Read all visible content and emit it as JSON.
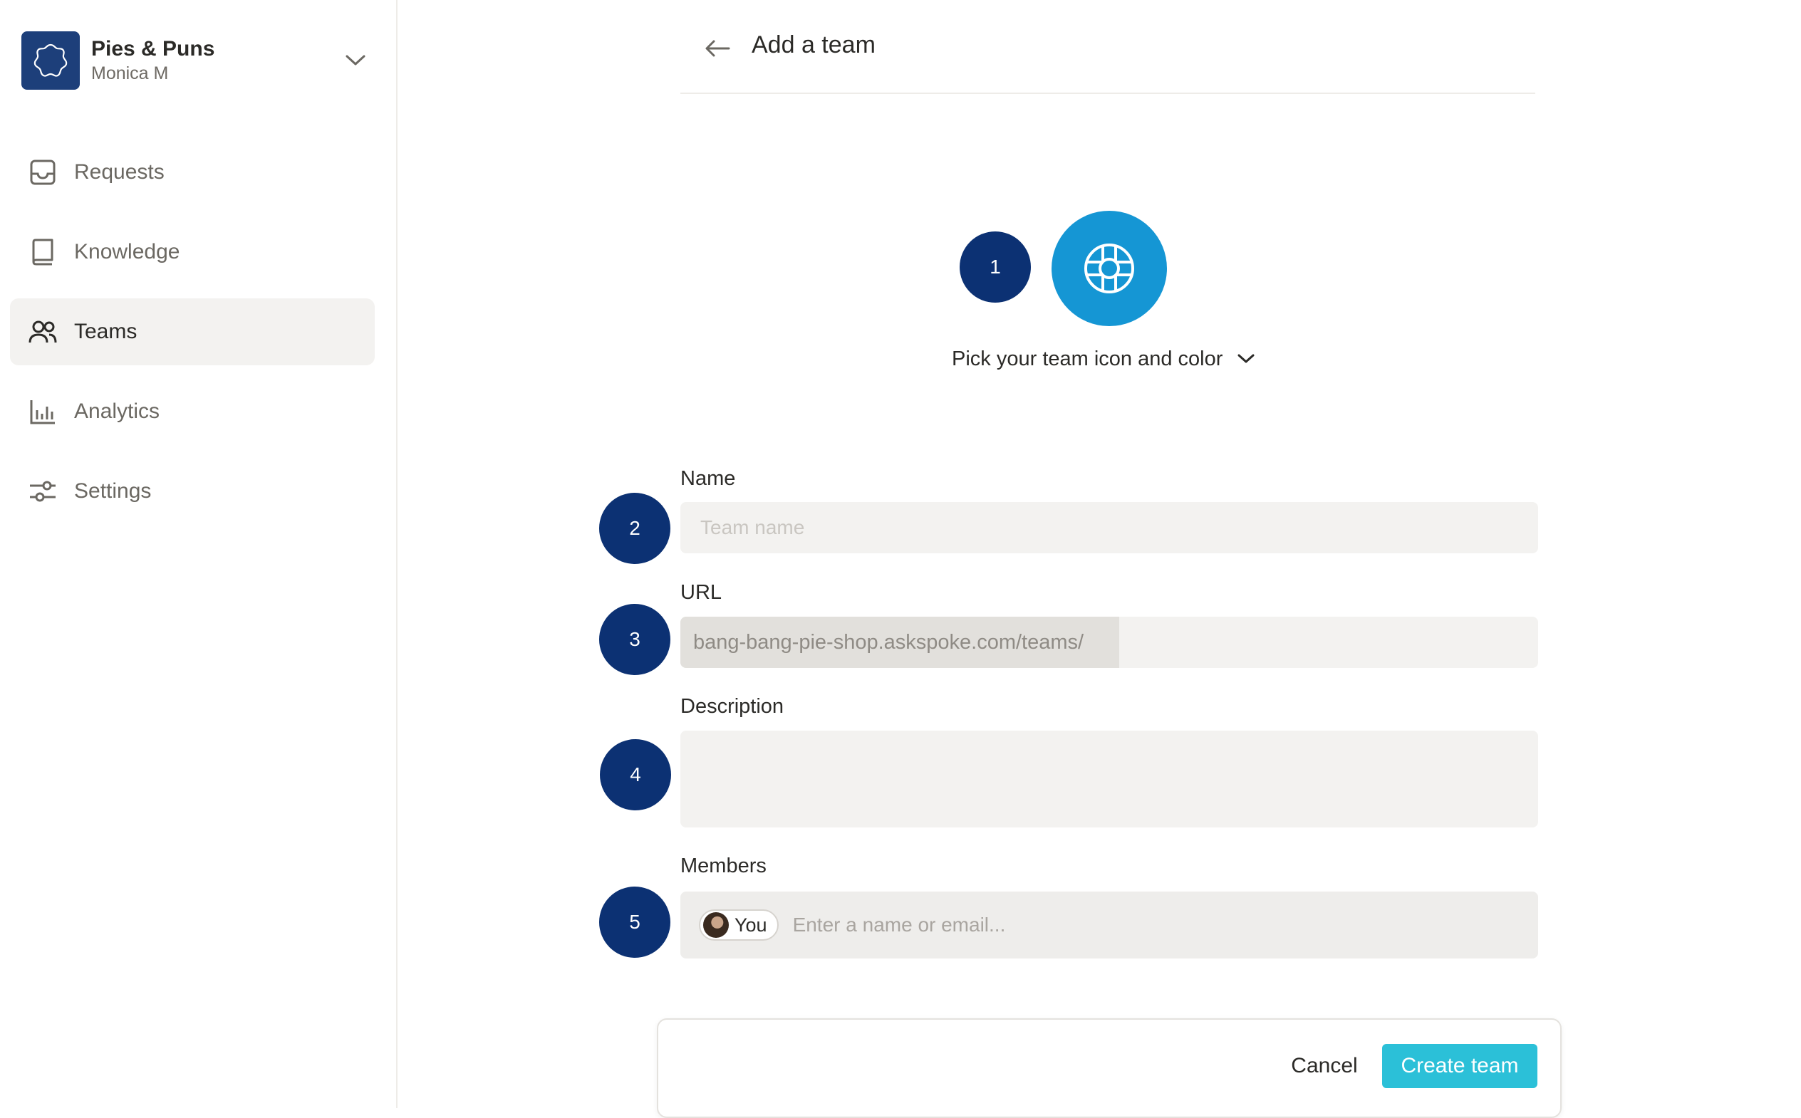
{
  "workspace": {
    "name": "Pies & Puns",
    "user": "Monica M"
  },
  "sidebar": {
    "items": [
      {
        "label": "Requests",
        "icon": "inbox-icon"
      },
      {
        "label": "Knowledge",
        "icon": "book-icon"
      },
      {
        "label": "Teams",
        "icon": "users-icon",
        "active": true
      },
      {
        "label": "Analytics",
        "icon": "bar-chart-icon"
      },
      {
        "label": "Settings",
        "icon": "sliders-icon"
      }
    ]
  },
  "header": {
    "title": "Add a team"
  },
  "steps": [
    "1",
    "2",
    "3",
    "4",
    "5"
  ],
  "icon_picker": {
    "label": "Pick your team icon and color",
    "icon": "lifebuoy-icon",
    "color": "#1596d4"
  },
  "form": {
    "name_label": "Name",
    "name_placeholder": "Team name",
    "url_label": "URL",
    "url_prefix": "bang-bang-pie-shop.askspoke.com/teams/",
    "url_value": "",
    "description_label": "Description",
    "description_value": "",
    "members_label": "Members",
    "member_chip": "You",
    "members_placeholder": "Enter a name or email..."
  },
  "footer": {
    "cancel_label": "Cancel",
    "create_label": "Create team"
  },
  "colors": {
    "step_badge": "#0c3173",
    "primary_button": "#2bc0d8",
    "workspace_logo": "#1d3f7a"
  }
}
